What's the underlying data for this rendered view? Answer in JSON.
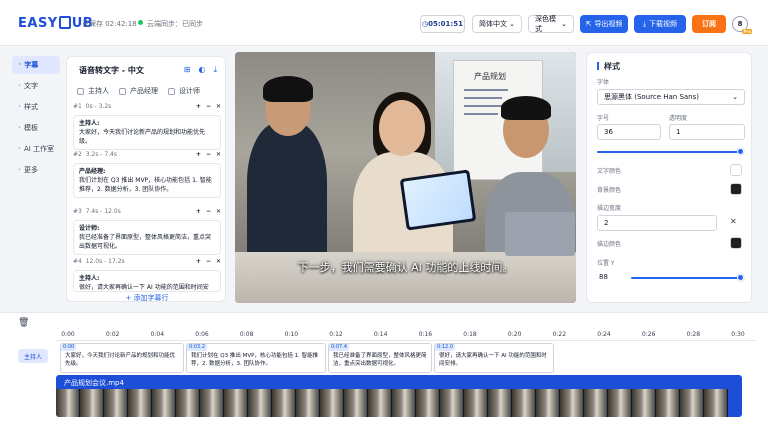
{
  "app": {
    "logo_left": "EASY",
    "logo_right": "UB",
    "save_status": "已保存 02:42:18",
    "sync_status": "云端同步：已同步",
    "timer": "05:01:51",
    "language_select": "简体中文",
    "theme_select": "深色模式",
    "export_label": "导出视频",
    "download_label": "下载视频",
    "subscribe_label": "订阅",
    "avatar_letter": "8",
    "avatar_badge": "Pro"
  },
  "nav": {
    "items": [
      {
        "label": "字幕",
        "active": true
      },
      {
        "label": "文字",
        "active": false
      },
      {
        "label": "样式",
        "active": false
      },
      {
        "label": "模板",
        "active": false
      },
      {
        "label": "AI 工作室",
        "active": false
      },
      {
        "label": "更多",
        "active": false
      }
    ]
  },
  "subtitles": {
    "title": "语音转文字 - 中文",
    "roles": [
      "主持人",
      "产品经理",
      "设计师"
    ],
    "segments": [
      {
        "index": "#1",
        "time": "0s - 3.2s",
        "speaker": "主持人:",
        "text": "大家好，今天我们讨论新产品的规划和功能优先级。"
      },
      {
        "index": "#2",
        "time": "3.2s - 7.4s",
        "speaker": "产品经理:",
        "text": "我们计划在 Q3 推出 MVP，核心功能包括 1. 智能推荐，2. 数据分析，3. 团队协作。"
      },
      {
        "index": "#3",
        "time": "7.4s - 12.0s",
        "speaker": "设计师:",
        "text": "我已经准备了界面原型，整体风格更简洁，重点突出数据可视化。"
      },
      {
        "index": "#4",
        "time": "12.0s - 17.2s",
        "speaker": "主持人:",
        "text": "很好，请大家再确认一下 AI 功能的范围和时间安排。"
      }
    ],
    "add_label": "+ 添加字幕行"
  },
  "video": {
    "caption": "下一步，我们需要确认 AI 功能的上线时间。",
    "whiteboard_title": "产品规划"
  },
  "style": {
    "title": "样式",
    "font_label": "字体",
    "font_value": "思源黑体 (Source Han Sans)",
    "size_label": "字号",
    "size_value": "36",
    "opacity_label": "透明度",
    "opacity_value": "1",
    "text_color_label": "文字颜色",
    "bg_color_label": "背景颜色",
    "stroke_width_label": "描边宽度",
    "stroke_width_value": "2",
    "stroke_color_label": "描边颜色",
    "position_label": "位置 Y",
    "position_value": "88",
    "text_color": "#ffffff",
    "bg_color": "#1f1f1f",
    "stroke_color": "#1f1f1f",
    "accent": "#2563eb"
  },
  "timeline": {
    "ticks": [
      "0:00",
      "0:02",
      "0:04",
      "0:06",
      "0:08",
      "0:10",
      "0:12",
      "0:14",
      "0:16",
      "0:18",
      "0:20",
      "0:22",
      "0:24",
      "0:26",
      "0:28",
      "0:30"
    ],
    "track_label": "主持人",
    "clips": [
      {
        "ts": "0:00",
        "text": "大家好，今天我们讨论新产品的规划和功能优先级。"
      },
      {
        "ts": "0:03.2",
        "text": "我们计划在 Q3 推出 MVP，核心功能包括 1. 智能推荐，2. 数据分析，3. 团队协作。"
      },
      {
        "ts": "0:07.4",
        "text": "我已经准备了界面原型，整体风格更简洁，重点突出数据可视化。"
      },
      {
        "ts": "0:12.0",
        "text": "很好，请大家再确认一下 AI 功能的范围和时间安排。"
      }
    ],
    "video_track_name": "产品规划会议.mp4"
  }
}
